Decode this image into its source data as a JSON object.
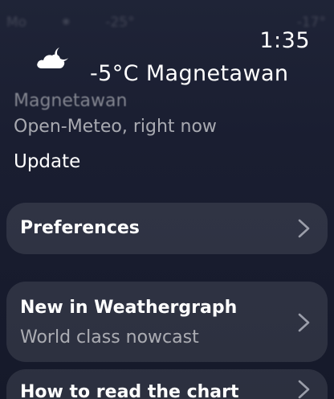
{
  "background_strip": {
    "left": "Mo",
    "mid1": "⁕",
    "mid2": "-25°",
    "right": "-17°"
  },
  "header": {
    "time": "1:35",
    "temperature_location": "-5°C Magnetawan",
    "weather_icon": "cloud-moon-icon"
  },
  "info": {
    "location": "Magnetawan",
    "source": "Open-Meteo, right now",
    "update_label": "Update"
  },
  "cards": {
    "preferences": {
      "title": "Preferences"
    },
    "whats_new": {
      "title": "New in Weathergraph",
      "subtitle": "World class nowcast"
    },
    "how_to": {
      "title": "How to read the chart"
    }
  },
  "colors": {
    "background": "#1a1e31",
    "card": "#2c3043",
    "text_primary": "#ffffff",
    "text_secondary": "#9b9eaa"
  }
}
